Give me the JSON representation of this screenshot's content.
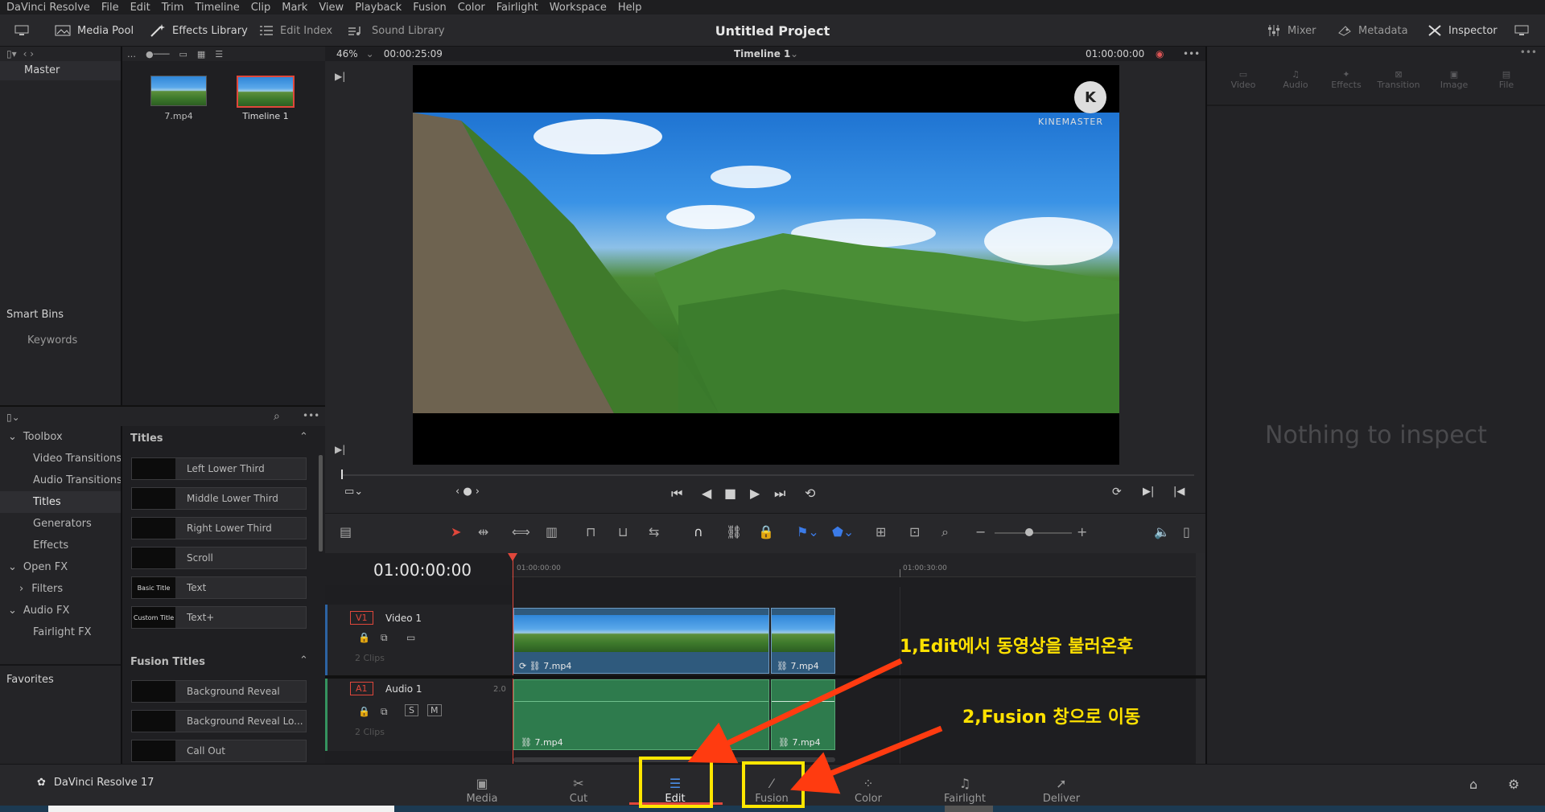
{
  "menubar": [
    "DaVinci Resolve",
    "File",
    "Edit",
    "Trim",
    "Timeline",
    "Clip",
    "Mark",
    "View",
    "Playback",
    "Fusion",
    "Color",
    "Fairlight",
    "Workspace",
    "Help"
  ],
  "toolbar": {
    "media_pool": "Media Pool",
    "effects_library": "Effects Library",
    "edit_index": "Edit Index",
    "sound_library": "Sound Library",
    "project_title": "Untitled Project",
    "mixer": "Mixer",
    "metadata": "Metadata",
    "inspector": "Inspector"
  },
  "viewer": {
    "zoom": "46%",
    "timecode_duration": "00:00:25:09",
    "timeline_name": "Timeline 1",
    "timecode_current": "01:00:00:00",
    "watermark": "KINEMASTER"
  },
  "media_pool": {
    "master": "Master",
    "smart_bins": "Smart Bins",
    "keywords": "Keywords",
    "clips": [
      {
        "name": "7.mp4",
        "selected": false
      },
      {
        "name": "Timeline 1",
        "selected": true
      }
    ]
  },
  "effects": {
    "tree": [
      "Toolbox",
      "Video Transitions",
      "Audio Transitions",
      "Titles",
      "Generators",
      "Effects",
      "Open FX",
      "Filters",
      "Audio FX",
      "Fairlight FX"
    ],
    "favorites": "Favorites",
    "titles_header": "Titles",
    "titles": [
      {
        "thumb": "",
        "label": "Left Lower Third"
      },
      {
        "thumb": "",
        "label": "Middle Lower Third"
      },
      {
        "thumb": "",
        "label": "Right Lower Third"
      },
      {
        "thumb": "",
        "label": "Scroll"
      },
      {
        "thumb": "Basic Title",
        "label": "Text"
      },
      {
        "thumb": "Custom Title",
        "label": "Text+"
      }
    ],
    "fusion_titles_header": "Fusion Titles",
    "fusion_titles": [
      {
        "label": "Background Reveal"
      },
      {
        "label": "Background Reveal Lo..."
      },
      {
        "label": "Call Out"
      }
    ]
  },
  "timeline": {
    "timecode": "01:00:00:00",
    "ruler_start": "01:00:00:00",
    "ruler_mid": "01:00:30:00",
    "video_track": {
      "id": "V1",
      "name": "Video 1",
      "clips_count": "2 Clips"
    },
    "audio_track": {
      "id": "A1",
      "name": "Audio 1",
      "channels": "2.0",
      "clips_count": "2 Clips"
    },
    "clip_a_label": "7.mp4",
    "clip_b_label": "7.mp4"
  },
  "inspector": {
    "tabs": [
      "Video",
      "Audio",
      "Effects",
      "Transition",
      "Image",
      "File"
    ],
    "empty_message": "Nothing to inspect"
  },
  "bottom_bar": {
    "app_name": "DaVinci Resolve 17",
    "tabs": [
      "Media",
      "Cut",
      "Edit",
      "Fusion",
      "Color",
      "Fairlight",
      "Deliver"
    ],
    "active_tab": "Edit"
  },
  "annotations": {
    "step1": "1,Edit에서 동영상을 불러온후",
    "step2": "2,Fusion 창으로 이동"
  },
  "colors": {
    "accent_red": "#e0473b",
    "highlight_yellow": "#ffe600",
    "annotation_arrow": "#ff3b10"
  }
}
